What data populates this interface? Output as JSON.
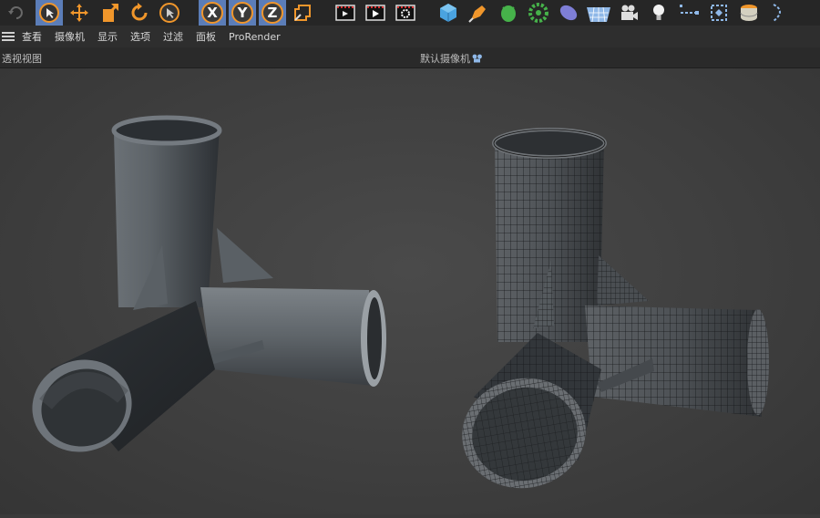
{
  "toolbar": {
    "icons": [
      "undo-icon",
      "select-icon",
      "move-icon",
      "scale-icon",
      "rotate-icon",
      "live-select-icon",
      "x-axis-icon",
      "y-axis-icon",
      "z-axis-icon",
      "coordinate-system-icon",
      "render-region-icon",
      "render-view-icon",
      "render-settings-icon",
      "cube-icon",
      "pen-icon",
      "subdivision-icon",
      "cloner-icon",
      "deformer-icon",
      "floor-icon",
      "camera-icon",
      "light-icon",
      "spline-tool-icon",
      "polygon-tool-icon",
      "material-icon",
      "spline-icon"
    ],
    "x_label": "X",
    "y_label": "Y",
    "z_label": "Z"
  },
  "menu": {
    "items": [
      "查看",
      "摄像机",
      "显示",
      "选项",
      "过滤",
      "面板",
      "ProRender"
    ]
  },
  "viewport": {
    "view_name": "透视视图",
    "camera": "默认摄像机"
  },
  "colors": {
    "accent": "#f0962b",
    "selected": "#5b7db8",
    "toolbar_bg": "#262626",
    "viewport_bg": "#3f3f3f"
  }
}
